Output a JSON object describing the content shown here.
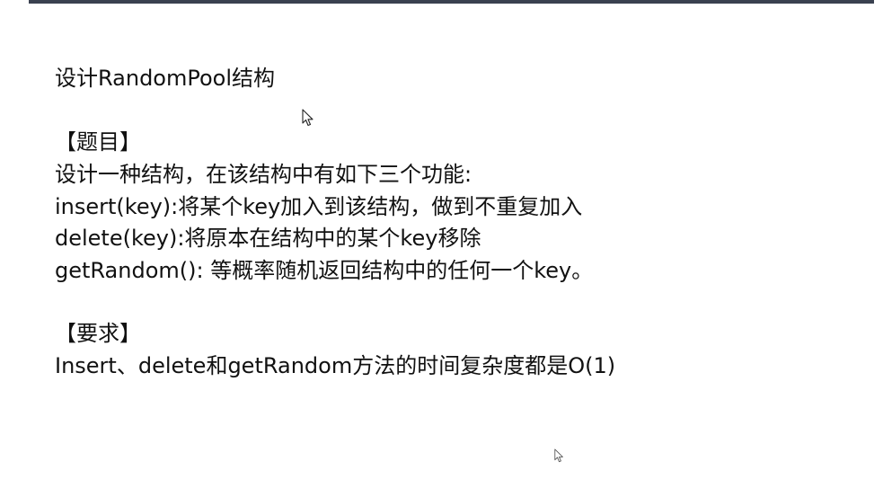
{
  "document": {
    "title": "设计RandomPool结构",
    "section_problem": "【题目】",
    "problem_lines": [
      "设计一种结构，在该结构中有如下三个功能:",
      "insert(key):将某个key加入到该结构，做到不重复加入",
      "delete(key):将原本在结构中的某个key移除",
      "getRandom(): 等概率随机返回结构中的任何一个key。"
    ],
    "section_requirement": "【要求】",
    "requirement_line": "Insert、delete和getRandom方法的时间复杂度都是O(1)"
  },
  "icons": {
    "cursor": "mouse-pointer-icon"
  }
}
